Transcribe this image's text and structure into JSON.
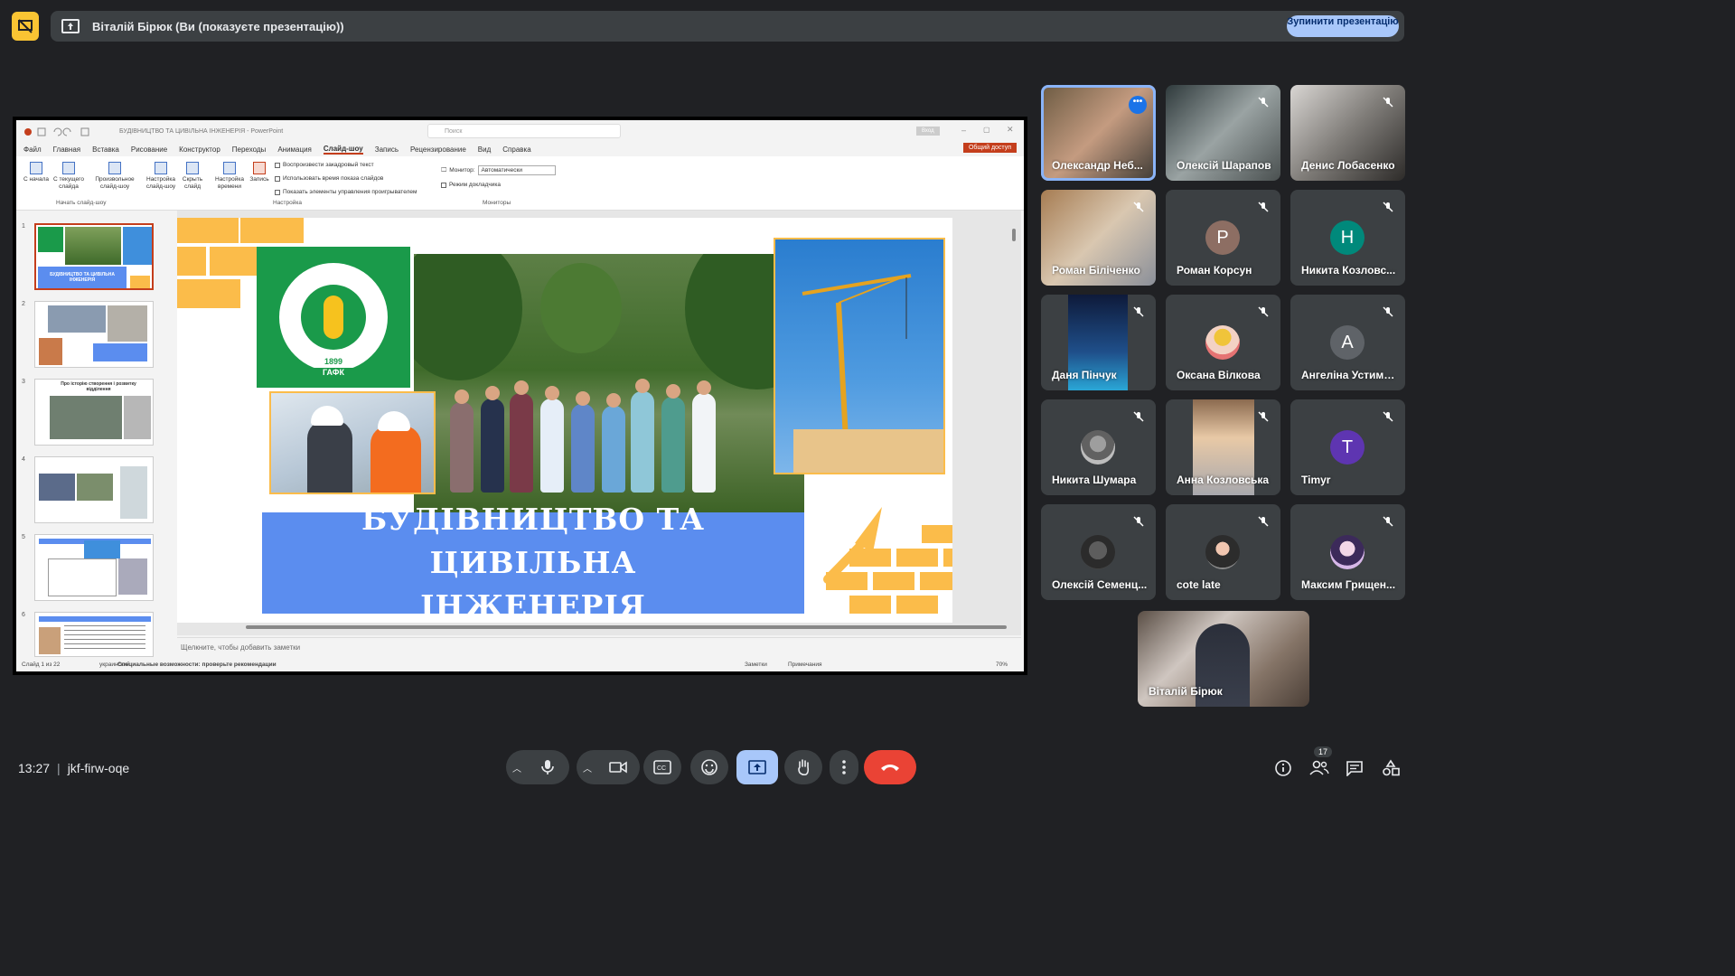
{
  "header": {
    "presenting_text": "Віталій Бірюк (Ви (показуєте презентацію))",
    "stop_button_label": "Зупинити презентацію",
    "present_icon": "present-to-all-icon",
    "stop_icon": "stop-presenting-icon"
  },
  "powerpoint": {
    "doc_title": "БУДІВНИЦТВО ТА ЦИВІЛЬНА ІНЖЕНЕРІЯ - PowerPoint",
    "search_placeholder": "Поиск",
    "signin_label": "Вход",
    "share_label": "Общий доступ",
    "tabs": [
      "Файл",
      "Главная",
      "Вставка",
      "Рисование",
      "Конструктор",
      "Переходы",
      "Анимация",
      "Слайд-шоу",
      "Запись",
      "Рецензирование",
      "Вид",
      "Справка"
    ],
    "active_tab": "Слайд-шоу",
    "ribbon": {
      "from_start": "С начала",
      "from_current": "С текущего слайда",
      "custom_show": "Произвольное слайд-шоу",
      "setup_show": "Настройка слайд-шоу",
      "hide_slide": "Скрыть слайд",
      "rehearse": "Настройка времени",
      "record": "Запись",
      "play_narrations": "Воспроизвести закадровый текст",
      "use_timings": "Использовать время показа слайдов",
      "show_media_controls": "Показать элементы управления проигрывателем",
      "monitor_label": "Монитор:",
      "monitor_value": "Автоматически",
      "presenter_view": "Режим докладчика",
      "group_start": "Начать слайд-шоу",
      "group_setup": "Настройка",
      "group_monitors": "Мониторы"
    },
    "thumbnails": [
      "1",
      "2",
      "3",
      "4",
      "5",
      "6"
    ],
    "thumb3_text": "Про історію створення і розвитку відділення",
    "slide": {
      "title_line1": "БУДІВНИЦТВО ТА ЦИВІЛЬНА",
      "title_line2": "ІНЖЕНЕРІЯ",
      "logo_year": "1899",
      "logo_abbr": "ГАФК",
      "thumb1_title": "БУДІВНИЦТВО ТА ЦИВІЛЬНА ІНЖЕНЕРІЯ"
    },
    "notes_placeholder": "Щелкните, чтобы добавить заметки",
    "status": {
      "slide_count": "Слайд 1 из 22",
      "language": "украинский",
      "accessibility": "Специальные возможности: проверьте рекомендации",
      "notes": "Заметки",
      "comments": "Примечания",
      "zoom": "70%"
    }
  },
  "participants": [
    {
      "name": "Олександр Неб...",
      "kind": "video",
      "active": true
    },
    {
      "name": "Олексій Шарапов",
      "kind": "video"
    },
    {
      "name": "Денис Лобасенко",
      "kind": "video"
    },
    {
      "name": "Роман Біліченко",
      "kind": "video"
    },
    {
      "name": "Роман Корсун",
      "kind": "letter",
      "letter": "Р",
      "color": "#8d6e63"
    },
    {
      "name": "Никита Козловс...",
      "kind": "letter",
      "letter": "Н",
      "color": "#00897b"
    },
    {
      "name": "Даня Пінчук",
      "kind": "video"
    },
    {
      "name": "Оксана Вілкова",
      "kind": "photo"
    },
    {
      "name": "Ангеліна Устиме...",
      "kind": "letter",
      "letter": "А",
      "color": "#5f6368"
    },
    {
      "name": "Никита Шумара",
      "kind": "photo"
    },
    {
      "name": "Анна Козловська",
      "kind": "video"
    },
    {
      "name": "Timyr",
      "kind": "letter",
      "letter": "T",
      "color": "#5e35b1"
    },
    {
      "name": "Олексій Семенц...",
      "kind": "photo"
    },
    {
      "name": "cote late",
      "kind": "photo"
    },
    {
      "name": "Максим Грищен...",
      "kind": "photo"
    }
  ],
  "self_view": {
    "name": "Віталій Бірюк"
  },
  "bottom": {
    "time": "13:27",
    "meeting_code": "jkf-firw-oqe",
    "participant_count": "17",
    "icons": [
      "mic-icon",
      "camera-icon",
      "captions-icon",
      "emoji-icon",
      "present-icon",
      "raise-hand-icon",
      "more-options-icon",
      "end-call-icon",
      "info-icon",
      "people-icon",
      "chat-icon",
      "activities-icon"
    ]
  },
  "colors": {
    "background": "#202124",
    "surface": "#3c4043",
    "accent_blue": "#a8c7fa",
    "end_call_red": "#ea4335",
    "warning_yellow": "#f9c433",
    "ppt_accent": "#c43e1c",
    "slide_blue": "#5b8def",
    "slide_orange": "#fbbc4a",
    "logo_green": "#1a9a4a"
  }
}
